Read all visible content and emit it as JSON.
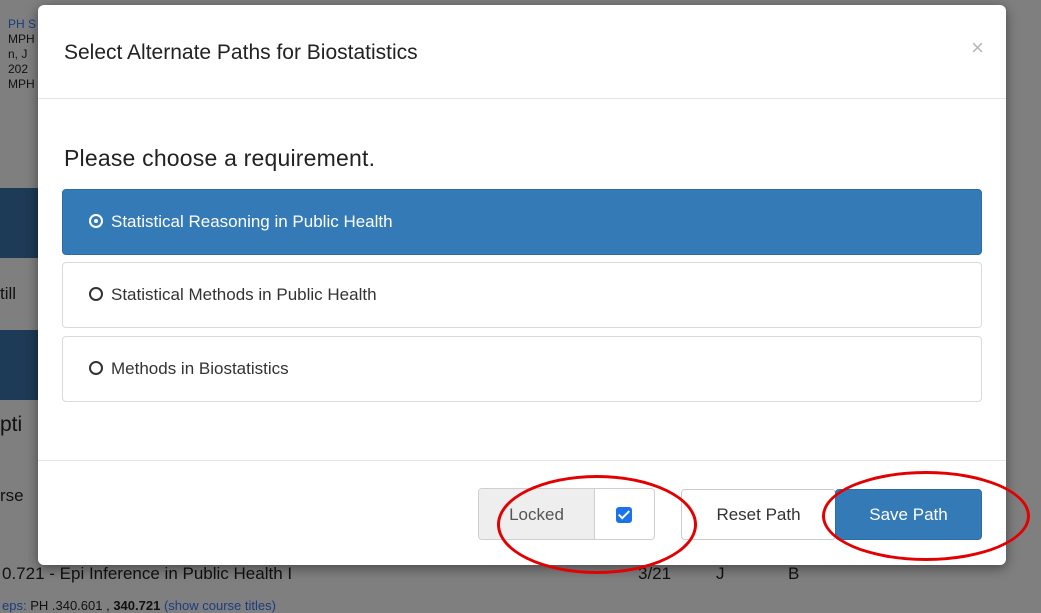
{
  "background": {
    "header_fragments": [
      "PH S",
      "MPH",
      "n, J",
      "202",
      "MPH"
    ],
    "side_fragments": [
      "till",
      "pti",
      "rse"
    ],
    "bottom_row": "0.721 - Epi Inference in Public Health I",
    "bottom_row_cols": [
      "3/21",
      "J",
      "B"
    ],
    "footer_prefix": "eps:",
    "footer_codes": "PH .340.601 ,",
    "footer_bold": "340.721",
    "footer_link": "(show course titles)"
  },
  "modal": {
    "title": "Select Alternate Paths for Biostatistics",
    "close_glyph": "×",
    "heading": "Please choose a requirement.",
    "options": [
      {
        "label": "Statistical Reasoning in Public Health",
        "selected": true
      },
      {
        "label": "Statistical Methods in Public Health",
        "selected": false
      },
      {
        "label": "Methods in Biostatistics",
        "selected": false
      }
    ],
    "footer": {
      "locked_label": "Locked",
      "locked_checked": true,
      "reset_label": "Reset Path",
      "save_label": "Save Path"
    }
  },
  "colors": {
    "primary": "#337ab7",
    "annotation": "#e20000",
    "checkbox": "#1a73e8"
  }
}
